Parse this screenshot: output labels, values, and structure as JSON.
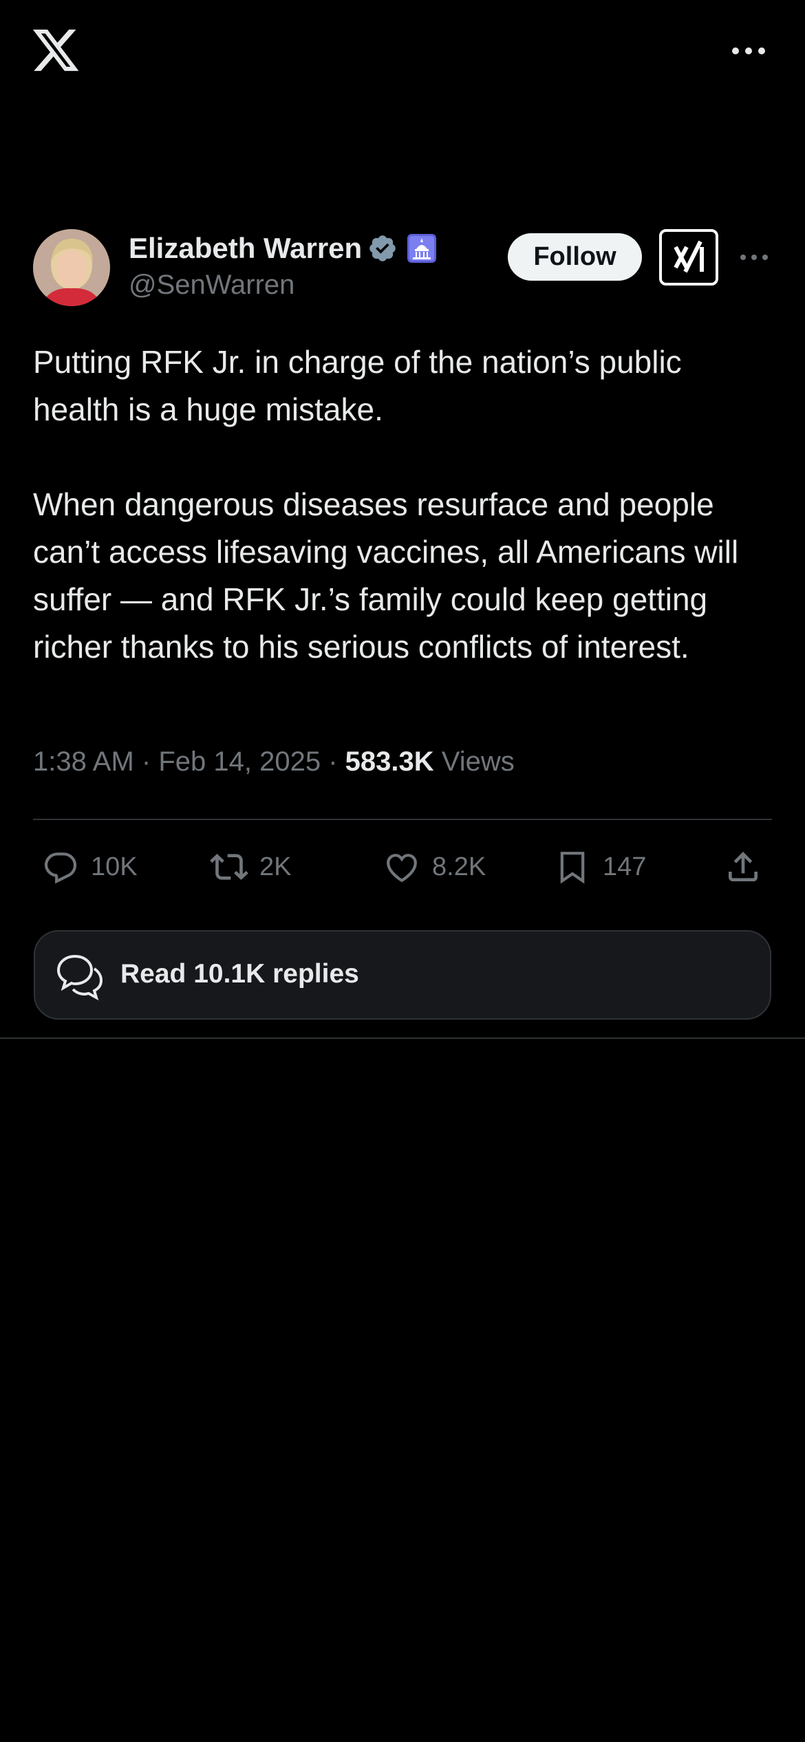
{
  "app": {
    "logo": "x-logo",
    "menu_icon": "more-horizontal-icon"
  },
  "author": {
    "name": "Elizabeth Warren",
    "handle": "@SenWarren",
    "verified_badge": "verified-badge-icon",
    "affiliation_badge": "us-capitol-badge-icon",
    "follow_label": "Follow"
  },
  "tweet": {
    "text": "Putting RFK Jr. in charge of the nation’s public health is a huge mistake.\n\nWhen dangerous diseases resurface and people can’t access lifesaving vaccines, all Americans will suffer — and RFK Jr.’s family could keep getting richer thanks to his serious conflicts of interest.",
    "time": "1:38 AM",
    "date": "Feb 14, 2025",
    "views_count": "583.3K",
    "views_label": "Views"
  },
  "actions": {
    "replies": "10K",
    "reposts": "2K",
    "likes": "8.2K",
    "bookmarks": "147"
  },
  "read_replies_label": "Read 10.1K replies",
  "colors": {
    "background": "#000000",
    "text": "#e7e9ea",
    "muted": "#71767b",
    "divider": "#2f3336",
    "follow_bg": "#eff3f4",
    "verified": "#829aab"
  }
}
